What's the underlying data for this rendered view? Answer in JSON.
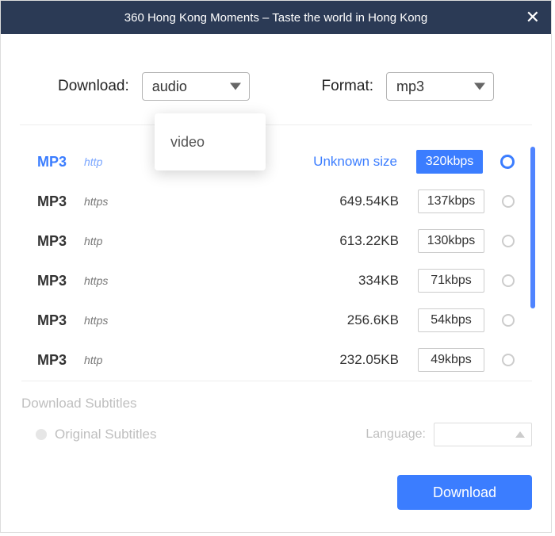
{
  "title": "360 Hong Kong Moments – Taste the world in Hong Kong",
  "controls": {
    "download_label": "Download:",
    "download_value": "audio",
    "format_label": "Format:",
    "format_value": "mp3"
  },
  "dropdown": {
    "item_video": "video"
  },
  "rows": [
    {
      "format": "MP3",
      "protocol": "http",
      "size": "Unknown size",
      "bitrate": "320kbps",
      "selected": true
    },
    {
      "format": "MP3",
      "protocol": "https",
      "size": "649.54KB",
      "bitrate": "137kbps",
      "selected": false
    },
    {
      "format": "MP3",
      "protocol": "http",
      "size": "613.22KB",
      "bitrate": "130kbps",
      "selected": false
    },
    {
      "format": "MP3",
      "protocol": "https",
      "size": "334KB",
      "bitrate": "71kbps",
      "selected": false
    },
    {
      "format": "MP3",
      "protocol": "https",
      "size": "256.6KB",
      "bitrate": "54kbps",
      "selected": false
    },
    {
      "format": "MP3",
      "protocol": "http",
      "size": "232.05KB",
      "bitrate": "49kbps",
      "selected": false
    }
  ],
  "subtitles": {
    "title": "Download Subtitles",
    "original": "Original Subtitles",
    "language_label": "Language:"
  },
  "footer": {
    "download_button": "Download"
  }
}
